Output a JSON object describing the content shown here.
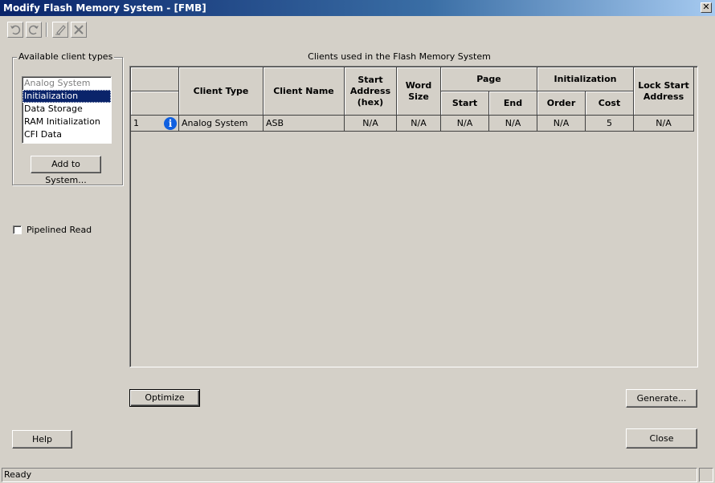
{
  "window": {
    "title": "Modify Flash Memory System - [FMB]",
    "close_glyph": "✕"
  },
  "toolbar": {
    "undo_icon": "undo-icon",
    "redo_icon": "redo-icon",
    "edit_icon": "edit-icon",
    "delete_icon": "delete-icon"
  },
  "available": {
    "group_label": "Available client types",
    "items": [
      "Analog System",
      "Initialization",
      "Data Storage",
      "RAM Initialization",
      "CFI Data"
    ],
    "selected_index": 1,
    "add_button": "Add to System..."
  },
  "pipelined_read": {
    "label": "Pipelined Read",
    "checked": false
  },
  "grid": {
    "caption": "Clients used in the Flash Memory System",
    "headers": {
      "client_type": "Client Type",
      "client_name": "Client Name",
      "start_address_line1": "Start",
      "start_address_line2": "Address",
      "start_address_line3": "(hex)",
      "word_size_line1": "Word",
      "word_size_line2": "Size",
      "page": "Page",
      "page_start": "Start",
      "page_end": "End",
      "initialization": "Initialization",
      "init_order": "Order",
      "init_cost": "Cost",
      "lock_line1": "Lock Start",
      "lock_line2": "Address"
    },
    "rows": [
      {
        "num": "1",
        "client_type": "Analog System",
        "client_name": "ASB",
        "start_address": "N/A",
        "word_size": "N/A",
        "page_start": "N/A",
        "page_end": "N/A",
        "init_order": "N/A",
        "init_cost": "5",
        "lock_start": "N/A"
      }
    ]
  },
  "buttons": {
    "optimize": "Optimize",
    "generate": "Generate...",
    "help": "Help",
    "close": "Close"
  },
  "status": {
    "text": "Ready"
  }
}
